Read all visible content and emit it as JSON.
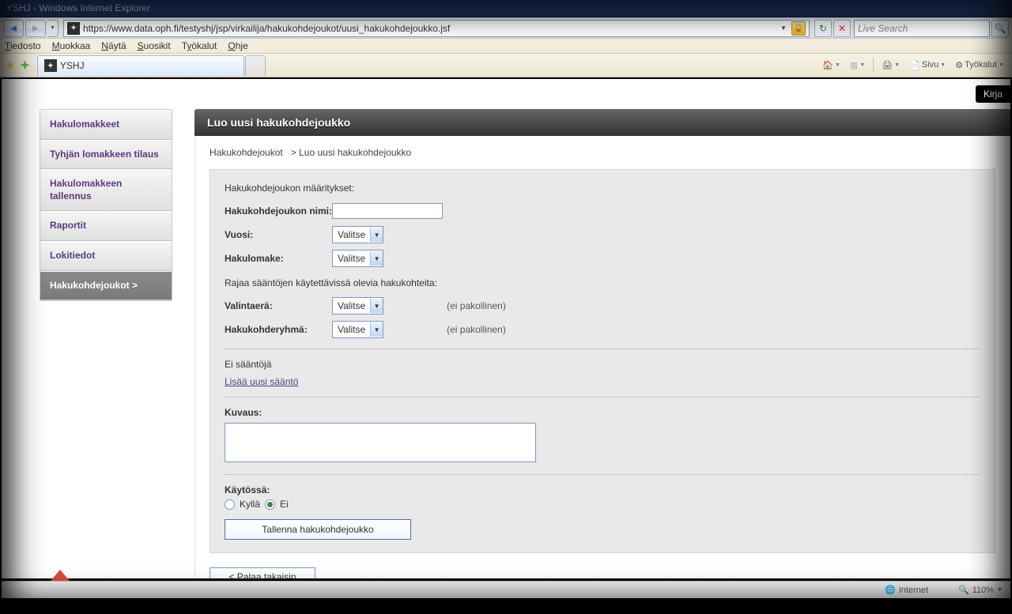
{
  "window": {
    "title": "YSHJ - Windows Internet Explorer"
  },
  "nav": {
    "url": "https://www.data.oph.fi/testyshj/jsp/virkailija/hakukohdejoukot/uusi_hakukohdejoukko.jsf",
    "search_placeholder": "Live Search"
  },
  "menu": {
    "file": "Tiedosto",
    "edit": "Muokkaa",
    "view": "Näytä",
    "favorites": "Suosikit",
    "tools": "Työkalut",
    "help": "Ohje"
  },
  "tab": {
    "label": "YSHJ"
  },
  "ie_tools": {
    "page": "Sivu",
    "tools": "Työkalut"
  },
  "topright": {
    "logout_prefix": "Kirja"
  },
  "sidebar": {
    "items": [
      {
        "label": "Hakulomakkeet"
      },
      {
        "label": "Tyhjän lomakkeen tilaus"
      },
      {
        "label": "Hakulomakkeen tallennus"
      },
      {
        "label": "Raportit"
      },
      {
        "label": "Lokitiedot"
      },
      {
        "label": "Hakukohdejoukot >"
      }
    ]
  },
  "main": {
    "title": "Luo uusi hakukohdejoukko",
    "breadcrumb_root": "Hakukohdejoukot",
    "breadcrumb_sep": ">",
    "breadcrumb_leaf": "Luo uusi hakukohdejoukko"
  },
  "form": {
    "section1": "Hakukohdejoukon määritykset:",
    "name_label": "Hakukohdejoukon nimi:",
    "year_label": "Vuosi:",
    "hakulomake_label": "Hakulomake:",
    "section2": "Rajaa sääntöjen käytettävissä olevia hakukohteita:",
    "valintaera_label": "Valintaerä:",
    "hakukohderyhma_label": "Hakukohderyhmä:",
    "optional_hint": "(ei pakollinen)",
    "select_placeholder": "Valitse",
    "no_rules": "Ei sääntöjä",
    "add_rule": "Lisää uusi sääntö",
    "kuvaus_label": "Kuvaus:",
    "kaytossa_label": "Käytössä:",
    "radio_yes": "Kyllä",
    "radio_no": "Ei",
    "save_button": "Tallenna hakukohdejoukko",
    "back_button": "< Palaa takaisin"
  },
  "status": {
    "zone": "Internet",
    "zoom": "110%"
  }
}
